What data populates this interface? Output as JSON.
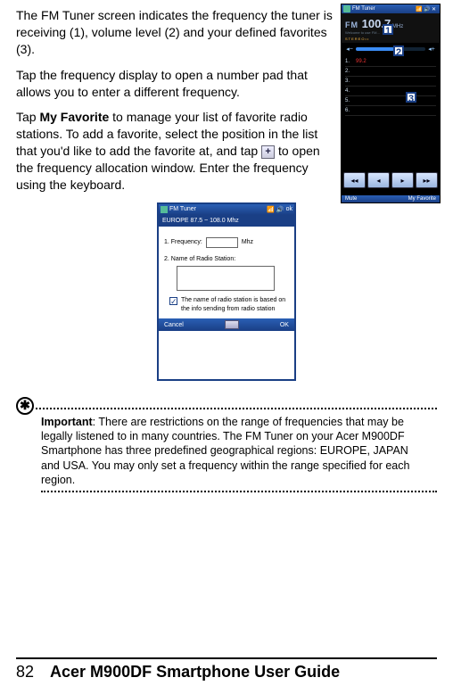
{
  "para1": "The FM Tuner screen indicates the frequency the tuner is receiving (1), volume level (2) and your defined favorites (3).",
  "para2": "Tap the frequency display to open a number pad that allows you to enter a different frequency.",
  "para3_a": "Tap ",
  "para3_bold": "My Favorite",
  "para3_b": " to manage your list of favorite radio stations. To add a favorite, select the position in the list that you'd like to add the favorite at, and tap ",
  "para3_c": " to open the frequency allocation window. Enter the frequency using the keyboard.",
  "plus_glyph": "+",
  "fm": {
    "app": "FM Tuner",
    "logo": "FM",
    "freq": "100.7",
    "unit": "MHz",
    "welcome": "Welcome to use FM...",
    "stereo": "STEREO••",
    "vol_minus": "◂−",
    "vol_plus": "◂+",
    "callout1": "1",
    "callout2": "2",
    "callout3": "3",
    "presets": [
      {
        "n": "1.",
        "v": "99.2"
      },
      {
        "n": "2.",
        "v": ""
      },
      {
        "n": "3.",
        "v": ""
      },
      {
        "n": "4.",
        "v": ""
      },
      {
        "n": "5.",
        "v": ""
      },
      {
        "n": "6.",
        "v": ""
      }
    ],
    "btn_prevscan": "◂◂",
    "btn_prev": "◂",
    "btn_next": "▸",
    "btn_nextscan": "▸▸",
    "mute": "Mute",
    "myfav": "My Favorite"
  },
  "dlg": {
    "app": "FM Tuner",
    "ok_top": "ok",
    "range": "EUROPE 87.5 ~ 108.0 Mhz",
    "row1_label": "1. Frequency:",
    "row1_unit": "Mhz",
    "row2_label": "2. Name of Radio Station:",
    "chk_text": "The name of radio station is based on the info sending from radio station",
    "cancel": "Cancel",
    "ok": "OK"
  },
  "note": {
    "strong": "Important",
    "text": ": There are restrictions on the range of frequencies that may be legally listened to in many countries. The FM Tuner on your Acer M900DF Smartphone has three predefined geographical regions: EUROPE, JAPAN and USA. You may only set a frequency within the range specified for each region."
  },
  "footer": {
    "page": "82",
    "title": "Acer M900DF Smartphone User Guide"
  }
}
